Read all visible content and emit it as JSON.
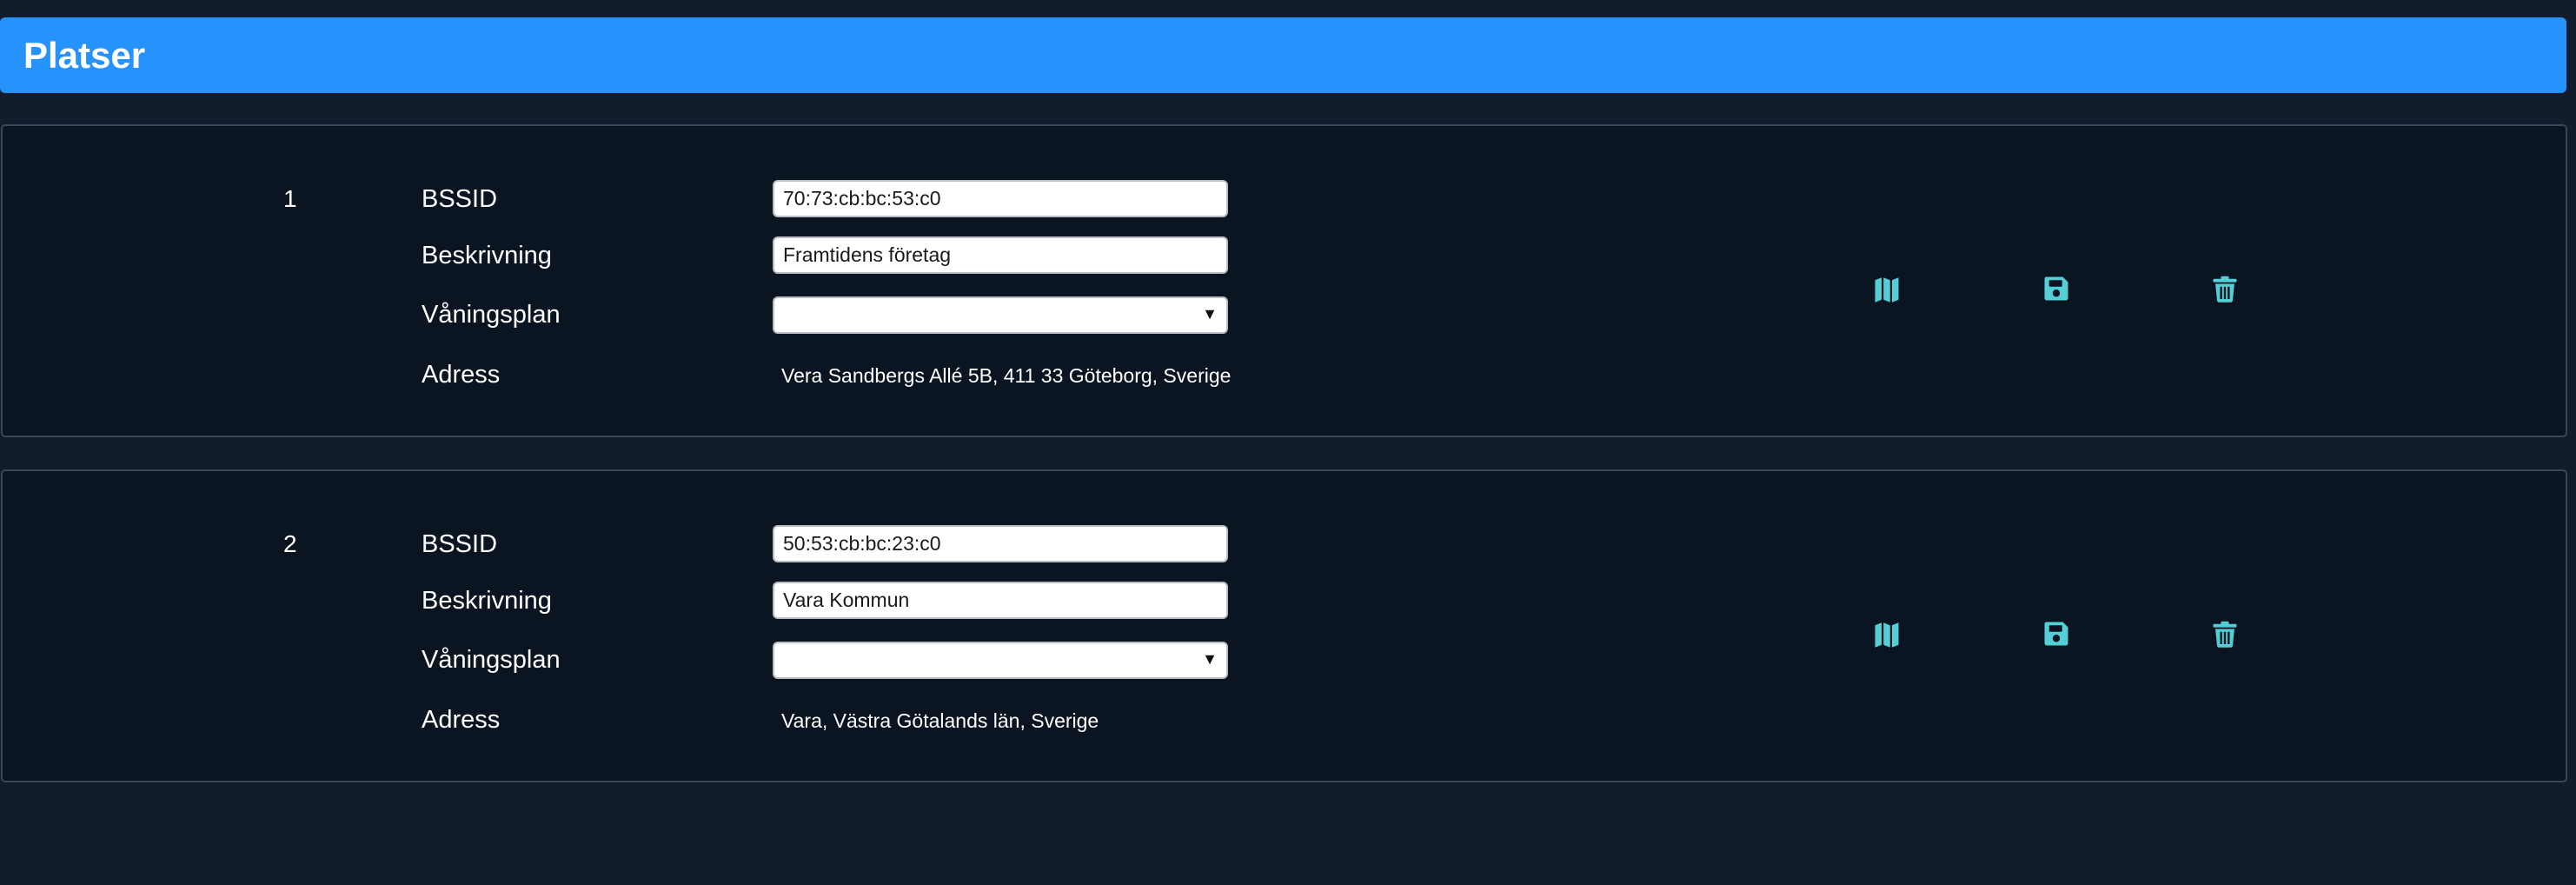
{
  "header": {
    "title": "Platser"
  },
  "labels": {
    "bssid": "BSSID",
    "description": "Beskrivning",
    "floor": "Våningsplan",
    "address": "Adress"
  },
  "colors": {
    "header": "#2692fc",
    "background": "#131c2c",
    "card": "#0b1421",
    "icon": "#54cfd6"
  },
  "locations": [
    {
      "index": "1",
      "bssid": "70:73:cb:bc:53:c0",
      "description": "Framtidens företag",
      "floor": "",
      "address": "Vera Sandbergs Allé 5B, 411 33 Göteborg, Sverige",
      "actions": [
        "map-icon",
        "save-icon",
        "trash-icon"
      ]
    },
    {
      "index": "2",
      "bssid": "50:53:cb:bc:23:c0",
      "description": "Vara Kommun",
      "floor": "",
      "address": "Vara, Västra Götalands län, Sverige",
      "actions": [
        "map-icon",
        "save-icon",
        "trash-icon"
      ]
    }
  ]
}
